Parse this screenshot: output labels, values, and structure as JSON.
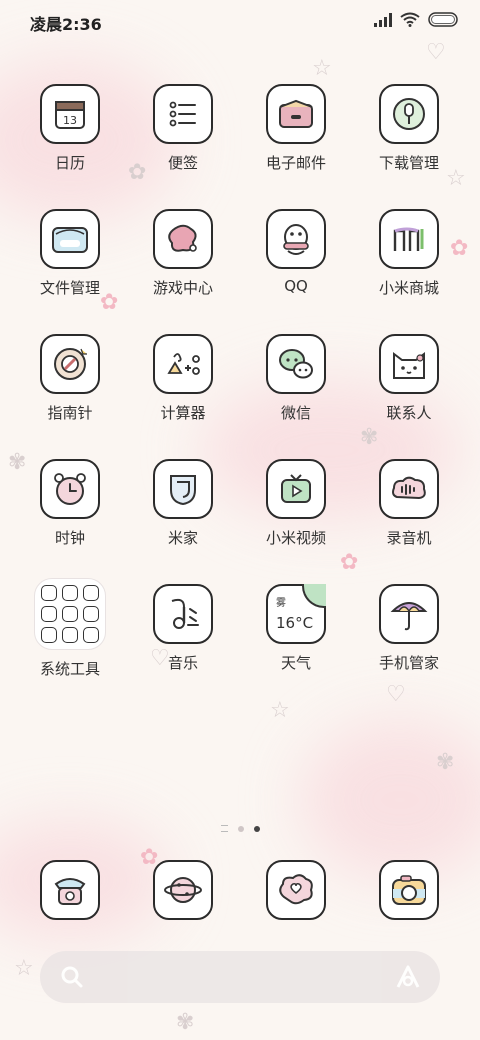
{
  "status": {
    "time": "凌晨2:36"
  },
  "apps": [
    [
      "日历",
      "便签",
      "电子邮件",
      "下载管理"
    ],
    [
      "文件管理",
      "游戏中心",
      "QQ",
      "小米商城"
    ],
    [
      "指南针",
      "计算器",
      "微信",
      "联系人"
    ],
    [
      "时钟",
      "米家",
      "小米视频",
      "录音机"
    ],
    [
      "系统工具",
      "音乐",
      "天气",
      "手机管家"
    ]
  ],
  "calendar_date": "13",
  "weather": {
    "condition": "雾",
    "temp": "16°C"
  },
  "page_indicator": {
    "pages": 3,
    "current": 3
  },
  "icons": {
    "row1": [
      "calendar-icon",
      "notes-icon",
      "email-icon",
      "download-icon"
    ],
    "row2": [
      "folder-icon",
      "game-center-icon",
      "qq-icon",
      "mi-store-icon"
    ],
    "row3": [
      "compass-icon",
      "calculator-icon",
      "wechat-icon",
      "contacts-icon"
    ],
    "row4": [
      "clock-icon",
      "mi-home-icon",
      "mi-video-icon",
      "recorder-icon"
    ],
    "row5": [
      "system-tools-folder",
      "music-icon",
      "weather-icon",
      "security-icon"
    ],
    "dock": [
      "phone-icon",
      "browser-icon",
      "messages-icon",
      "camera-icon"
    ],
    "search": [
      "search-icon",
      "assistant-icon"
    ]
  }
}
